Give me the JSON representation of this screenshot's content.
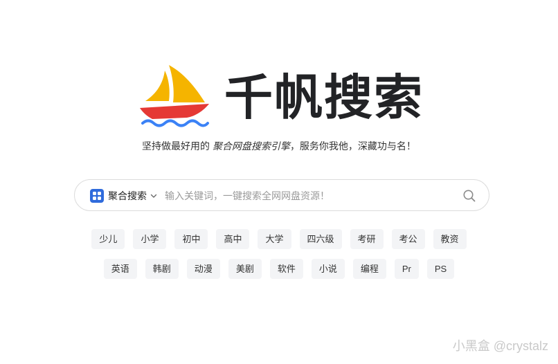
{
  "brand": {
    "title": "千帆搜索",
    "logo_icon": "sailboat-icon"
  },
  "slogan": {
    "prefix": "坚持做最好用的",
    "emphasis": "聚合网盘搜索引擎",
    "suffix": "，服务你我他，深藏功与名！"
  },
  "search": {
    "mode_icon": "grid-icon",
    "mode_label": "聚合搜索",
    "placeholder": "输入关键词，一键搜索全网网盘资源！",
    "value": "",
    "button_icon": "search-icon"
  },
  "tags": {
    "row1": [
      "少儿",
      "小学",
      "初中",
      "高中",
      "大学",
      "四六级",
      "考研",
      "考公",
      "教资"
    ],
    "row2": [
      "英语",
      "韩剧",
      "动漫",
      "美剧",
      "软件",
      "小说",
      "编程",
      "Pr",
      "PS"
    ]
  },
  "watermark": "小黑盒 @crystalz",
  "colors": {
    "sail_yellow": "#f5b400",
    "hull_red": "#e53935",
    "wave_blue": "#3b82f6",
    "title": "#222326",
    "mode_icon_bg": "#2f6bdc",
    "tag_bg": "#f3f4f6"
  }
}
